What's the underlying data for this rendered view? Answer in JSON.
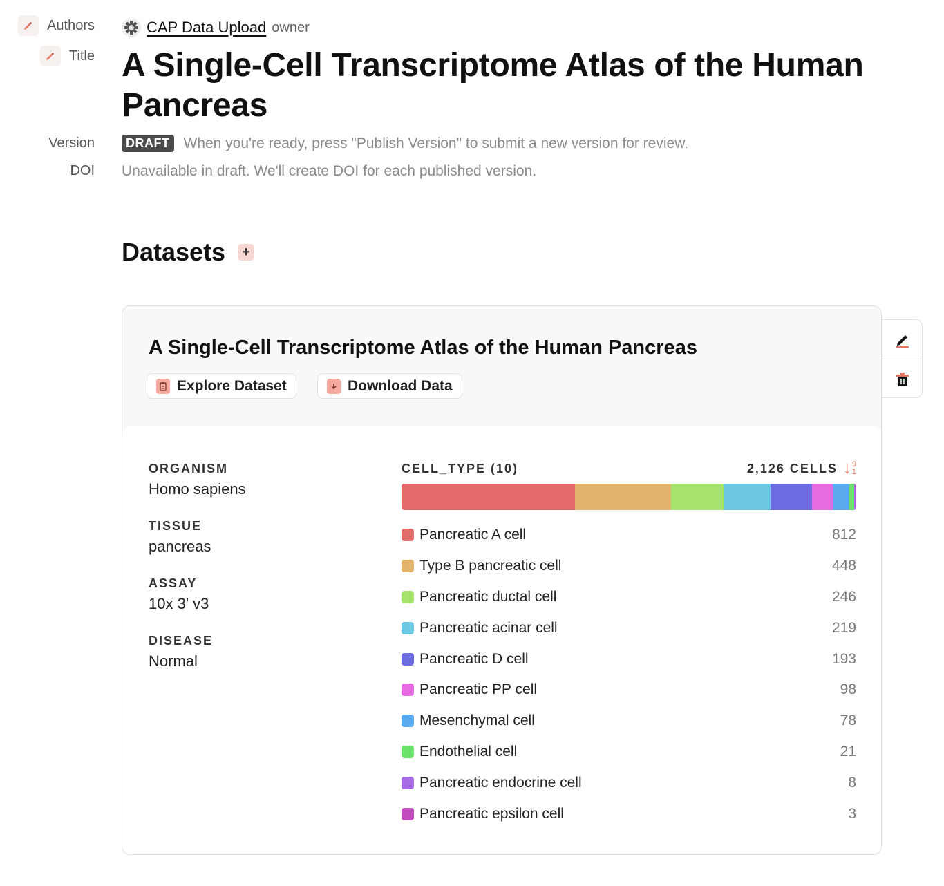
{
  "sidebar": {
    "authors_label": "Authors",
    "title_label": "Title",
    "version_label": "Version",
    "doi_label": "DOI"
  },
  "owner": {
    "name": "CAP Data Upload",
    "role": "owner"
  },
  "title": "A Single-Cell Transcriptome Atlas of the Human Pancreas",
  "version": {
    "badge": "DRAFT",
    "hint": "When you're ready, press \"Publish Version\" to submit a new version for review."
  },
  "doi_text": "Unavailable in draft. We'll create DOI for each published version.",
  "datasets": {
    "heading": "Datasets",
    "add_icon": "plus-icon"
  },
  "dataset_card": {
    "title": "A Single-Cell Transcriptome Atlas of the Human Pancreas",
    "explore_label": "Explore Dataset",
    "download_label": "Download Data",
    "metadata": [
      {
        "key": "ORGANISM",
        "value": "Homo sapiens"
      },
      {
        "key": "TISSUE",
        "value": "pancreas"
      },
      {
        "key": "ASSAY",
        "value": "10x 3' v3"
      },
      {
        "key": "DISEASE",
        "value": "Normal"
      }
    ],
    "cell_type_label": "CELL_TYPE (10)",
    "cells_label": "2,126 CELLS",
    "sort_digits": [
      "9",
      "1"
    ]
  },
  "colors": {
    "accent": "#f6a99d",
    "sort": "#e4765f"
  },
  "chart_data": {
    "type": "bar",
    "categories": [
      "Pancreatic A cell",
      "Type B pancreatic cell",
      "Pancreatic ductal cell",
      "Pancreatic acinar cell",
      "Pancreatic D cell",
      "Pancreatic PP cell",
      "Mesenchymal cell",
      "Endothelial cell",
      "Pancreatic endocrine cell",
      "Pancreatic epsilon cell"
    ],
    "values": [
      812,
      448,
      246,
      219,
      193,
      98,
      78,
      21,
      8,
      3
    ],
    "colors": [
      "#e46b6b",
      "#e2b36c",
      "#a6e36c",
      "#6cc7e2",
      "#6b6be2",
      "#e66be0",
      "#5aaaf0",
      "#6ce26b",
      "#a66be2",
      "#c14dbb"
    ],
    "stacked": true
  }
}
